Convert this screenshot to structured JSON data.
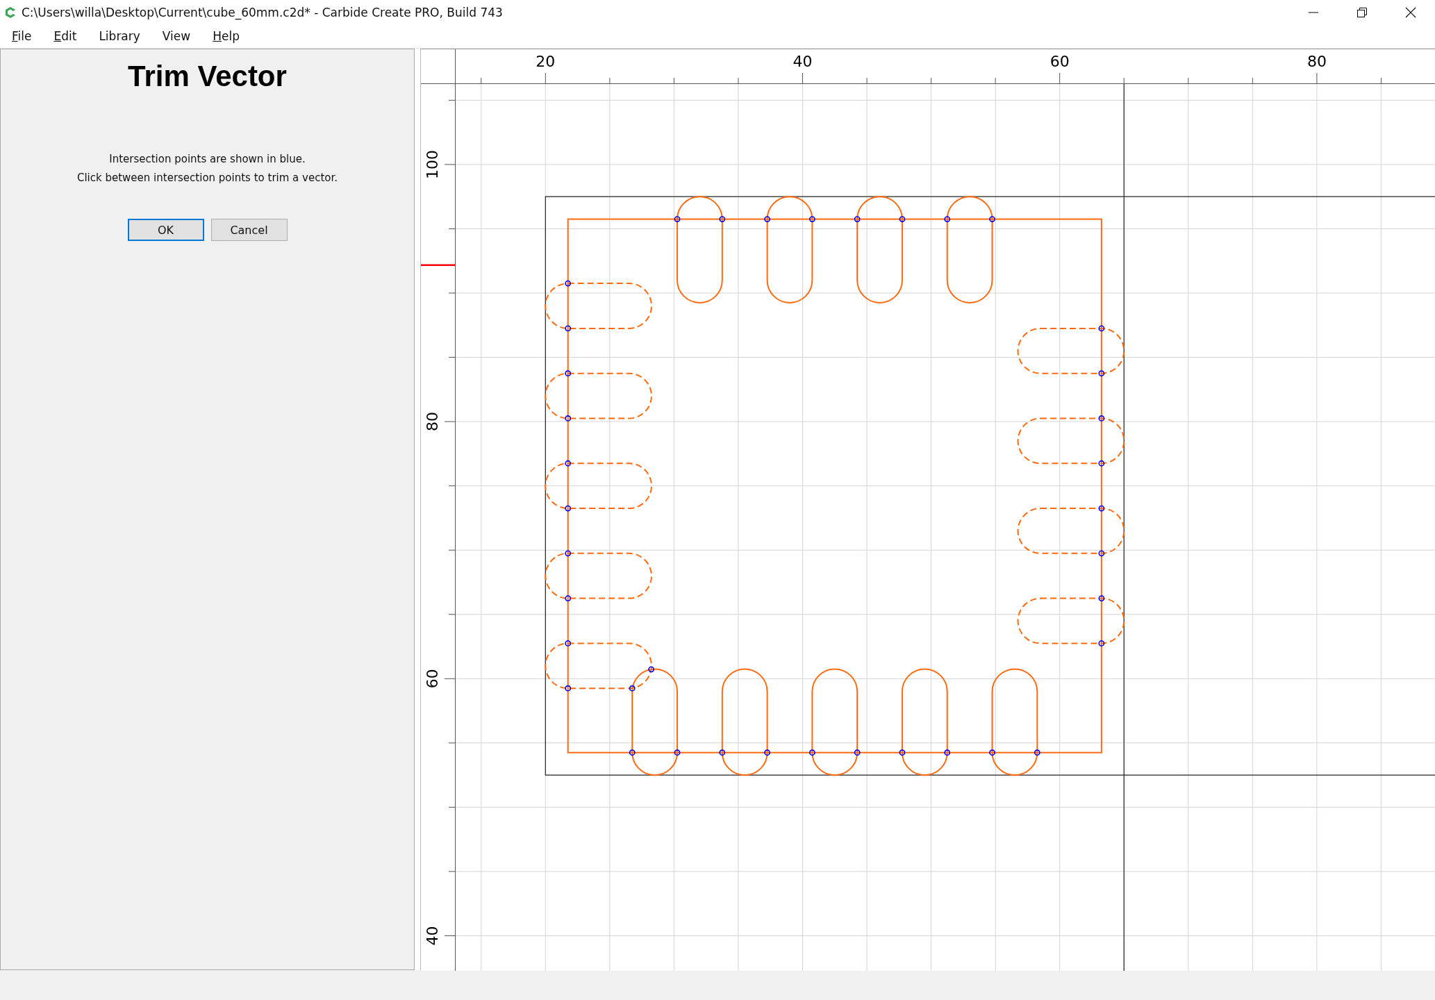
{
  "window": {
    "title": "C:\\Users\\willa\\Desktop\\Current\\cube_60mm.c2d* - Carbide Create PRO, Build 743"
  },
  "menu": [
    {
      "label": "File",
      "mnemonic": true
    },
    {
      "label": "Edit",
      "mnemonic": true
    },
    {
      "label": "Library",
      "mnemonic": false
    },
    {
      "label": "View",
      "mnemonic": false
    },
    {
      "label": "Help",
      "mnemonic": true
    }
  ],
  "panel": {
    "title": "Trim Vector",
    "instructions": [
      "Intersection points are shown in blue.",
      "Click between intersection points to trim a vector."
    ],
    "buttons": [
      {
        "label": "OK",
        "default": true
      },
      {
        "label": "Cancel",
        "default": false
      }
    ]
  },
  "canvas": {
    "top_ruler": {
      "labels": [
        "20",
        "40",
        "60",
        "80"
      ]
    },
    "left_ruler": {
      "labels": [
        "100",
        "80",
        "60",
        "40"
      ]
    }
  }
}
